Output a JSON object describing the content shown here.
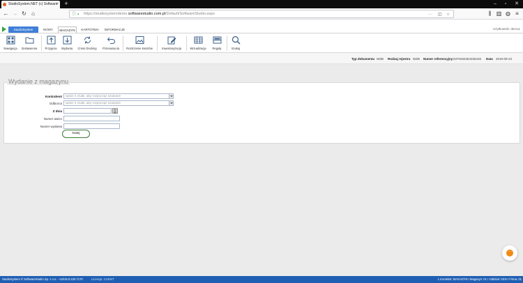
{
  "browser": {
    "tab_title": "StudioSystem.NET (c) Software",
    "url_prefix": "https://studiosystemdemo.",
    "url_domain": "softwarestudio.com.pl",
    "url_path": "/Default/SoftwareStudio.aspx",
    "back_icon": "arrow-left",
    "forward_icon": "arrow-right",
    "reload_icon": "reload",
    "home_icon": "home"
  },
  "app": {
    "brand": "StudioSystem",
    "user_label": "Użytkownik: demo1",
    "menu_tabs": [
      {
        "label": "NOWY",
        "active": false
      },
      {
        "label": "MAGAZYN",
        "active": true
      },
      {
        "label": "KARTOTEKI",
        "active": false
      },
      {
        "label": "INFORMACJE",
        "active": false
      }
    ],
    "ribbon": [
      {
        "label": "Nawigacja",
        "icon": "grid-icon"
      },
      {
        "label": "Zestawienia",
        "icon": "folder-icon"
      },
      {
        "label": "Przyjęcia",
        "icon": "upload-icon"
      },
      {
        "label": "Wydania",
        "icon": "download-icon"
      },
      {
        "label": "Cross Docking",
        "icon": "cycle-icon"
      },
      {
        "label": "Przesunięcia",
        "icon": "undo-arrow-icon"
      },
      {
        "label": "Rozliczenie kosztów",
        "icon": "image-icon"
      },
      {
        "label": "Inwentaryzacja",
        "icon": "edit-icon"
      },
      {
        "label": "Wizualizacja",
        "icon": "warehouse-icon"
      },
      {
        "label": "Regały",
        "icon": "shelf-icon"
      },
      {
        "label": "Szukaj",
        "icon": "search-icon"
      }
    ]
  },
  "info": {
    "typ_label": "Typ dokumentu",
    "typ_value": "WZB",
    "rodzaj_label": "Rodzaj rejestru",
    "rodzaj_value": "WZB",
    "numer_label": "Numer referencyjny",
    "numer_value": "6370484354336426",
    "data_label": "Data",
    "data_value": "2019-09-23"
  },
  "form": {
    "title": "Wydanie z magazynu",
    "kontrahent_label": "Kontrahent",
    "kontrahent_placeholder": "wpisz 2 znaki, aby rozpocząć szukanie",
    "odbiorca_label": "Odbiorca",
    "odbiorca_placeholder": "wpisz 2 znaki, aby rozpocząć szukanie",
    "zdnia_label": "Z dnia",
    "zdnia_value": "",
    "awizo_label": "Numer awizo",
    "awizo_value": "",
    "wydania_label": "Numer wydania",
    "wydania_value": "",
    "dalej_label": "Dalej"
  },
  "status": {
    "left": "StudioSystem © SoftwareStudio Sp. z o.o. - v2019.0.220.7170",
    "license": "Licencja: CLIENT",
    "right": "1 Kontekst: MAGAZYN I Magazyn: 01 I Oddział: CEN I Firma: 01"
  },
  "colors": {
    "brand_blue": "#3f7fd8",
    "status_blue": "#1f5fb3",
    "accent_green": "#36a23a",
    "chat_orange": "#f08a13"
  }
}
